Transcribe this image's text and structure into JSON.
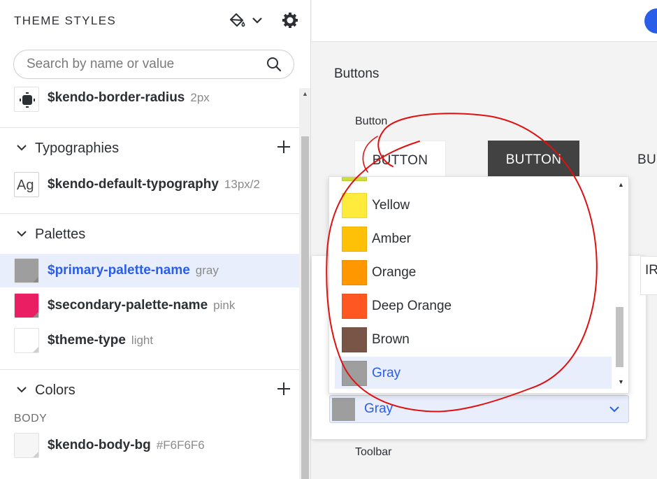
{
  "sidebar": {
    "title": "THEME STYLES",
    "search": {
      "placeholder": "Search by name or value",
      "value": ""
    },
    "top_variable": {
      "name": "$kendo-border-radius",
      "value": "2px"
    },
    "sections": [
      {
        "label": "Typographies",
        "items": [
          {
            "icon_text": "Ag",
            "name": "$kendo-default-typography",
            "value": "13px/2"
          }
        ]
      },
      {
        "label": "Palettes",
        "items": [
          {
            "name": "$primary-palette-name",
            "value": "gray",
            "swatch": "#9e9e9e"
          },
          {
            "name": "$secondary-palette-name",
            "value": "pink",
            "swatch": "#e91e63"
          },
          {
            "name": "$theme-type",
            "value": "light",
            "swatch": "#ffffff"
          }
        ]
      },
      {
        "label": "Colors",
        "group": "BODY",
        "items": [
          {
            "name": "$kendo-body-bg",
            "value": "#F6F6F6",
            "swatch": "#f6f6f6"
          }
        ]
      }
    ]
  },
  "main": {
    "heading": "Buttons",
    "button_group_label": "Button",
    "buttons": [
      "BUTTON",
      "BUTTON",
      "BU"
    ],
    "toolbar_label": "Toolbar",
    "tab_partial": "IR"
  },
  "palette_dropdown": {
    "selected": "Gray",
    "selected_swatch": "#9e9e9e",
    "options": [
      {
        "label": "Yellow",
        "color": "#ffeb3b"
      },
      {
        "label": "Amber",
        "color": "#ffc107"
      },
      {
        "label": "Orange",
        "color": "#ff9800"
      },
      {
        "label": "Deep Orange",
        "color": "#ff5722"
      },
      {
        "label": "Brown",
        "color": "#795548"
      },
      {
        "label": "Gray",
        "color": "#9e9e9e"
      }
    ],
    "partial_swatch_color": "#cddc39"
  },
  "colors": {
    "accent": "#2b5ee8",
    "annotation": "#e01010"
  }
}
